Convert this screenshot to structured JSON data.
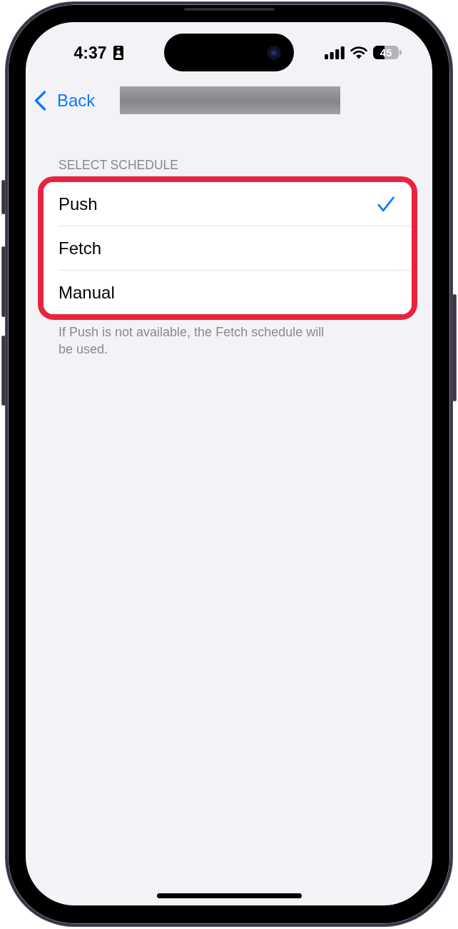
{
  "status_bar": {
    "time": "4:37",
    "battery": "45"
  },
  "nav": {
    "back": "Back",
    "title_blurred": true
  },
  "section": {
    "header": "SELECT SCHEDULE",
    "highlighted": true,
    "options": [
      {
        "label": "Push",
        "selected": true
      },
      {
        "label": "Fetch",
        "selected": false
      },
      {
        "label": "Manual",
        "selected": false
      }
    ],
    "footer": "If Push is not available, the Fetch schedule will be used."
  }
}
